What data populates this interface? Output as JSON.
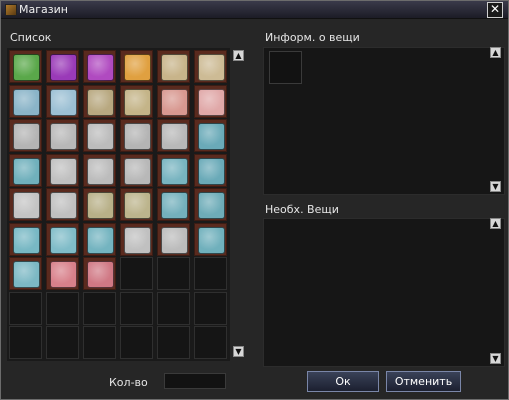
{
  "window": {
    "title": "Магазин",
    "close_label": "✕"
  },
  "list": {
    "label": "Список"
  },
  "info": {
    "label": "Информ. о вещи"
  },
  "required": {
    "label": "Необх. Вещи"
  },
  "quantity": {
    "label": "Кол-во",
    "value": ""
  },
  "buttons": {
    "ok": "Ок",
    "cancel": "Отменить"
  },
  "items": [
    {
      "name": "green-potion-icon",
      "color": "#5aa84a"
    },
    {
      "name": "purple-potion-icon",
      "color": "#9a3ab8"
    },
    {
      "name": "purple-flask-icon",
      "color": "#b04ac0"
    },
    {
      "name": "orange-flask-icon",
      "color": "#e0a040"
    },
    {
      "name": "scroll-icon",
      "color": "#c8b48a"
    },
    {
      "name": "scroll-icon",
      "color": "#cdbb95"
    },
    {
      "name": "blue-map-icon",
      "color": "#8ab4c8"
    },
    {
      "name": "blue-map-icon",
      "color": "#9cc0d4"
    },
    {
      "name": "tan-map-icon",
      "color": "#b8a880"
    },
    {
      "name": "tan-map-icon",
      "color": "#c4b488"
    },
    {
      "name": "pink-map-icon",
      "color": "#d89890"
    },
    {
      "name": "pink-map-icon",
      "color": "#e0a8a8"
    },
    {
      "name": "gray-manual-icon",
      "color": "#b4b4b4"
    },
    {
      "name": "gray-manual-icon",
      "color": "#b8b8b8"
    },
    {
      "name": "gray-manual-icon",
      "color": "#bcbcbc"
    },
    {
      "name": "gray-manual-icon",
      "color": "#b4b4b4"
    },
    {
      "name": "gray-manual-icon",
      "color": "#b8b8b8"
    },
    {
      "name": "blue-manual-icon",
      "color": "#6aaab8"
    },
    {
      "name": "blue-manual-icon",
      "color": "#70b0bc"
    },
    {
      "name": "gray-manual-icon",
      "color": "#c0c0c0"
    },
    {
      "name": "gray-manual-icon",
      "color": "#bcbcbc"
    },
    {
      "name": "gray-manual-icon",
      "color": "#b8b8b8"
    },
    {
      "name": "blue-manual-icon",
      "color": "#78b4c0"
    },
    {
      "name": "blue-manual-icon",
      "color": "#6aaab8"
    },
    {
      "name": "gray-manual-icon",
      "color": "#c4c4c4"
    },
    {
      "name": "gray-manual-icon",
      "color": "#c0c0c0"
    },
    {
      "name": "tan-manual-icon",
      "color": "#b8b088"
    },
    {
      "name": "tan-manual-icon",
      "color": "#bcb48c"
    },
    {
      "name": "blue-manual-icon",
      "color": "#74b0bc"
    },
    {
      "name": "blue-manual-icon",
      "color": "#6eacb8"
    },
    {
      "name": "blue-manual-icon",
      "color": "#78b8c4"
    },
    {
      "name": "blue-manual-icon",
      "color": "#80bcc8"
    },
    {
      "name": "blue-manual-icon",
      "color": "#74b4c0"
    },
    {
      "name": "gray-manual-icon",
      "color": "#c0c0c0"
    },
    {
      "name": "gray-manual-icon",
      "color": "#bcbcbc"
    },
    {
      "name": "blue-manual-icon",
      "color": "#70b0bc"
    },
    {
      "name": "blue-manual-icon",
      "color": "#7cb8c4"
    },
    {
      "name": "pink-manual-icon",
      "color": "#d8808a"
    },
    {
      "name": "pink-manual-icon",
      "color": "#d07884"
    }
  ]
}
